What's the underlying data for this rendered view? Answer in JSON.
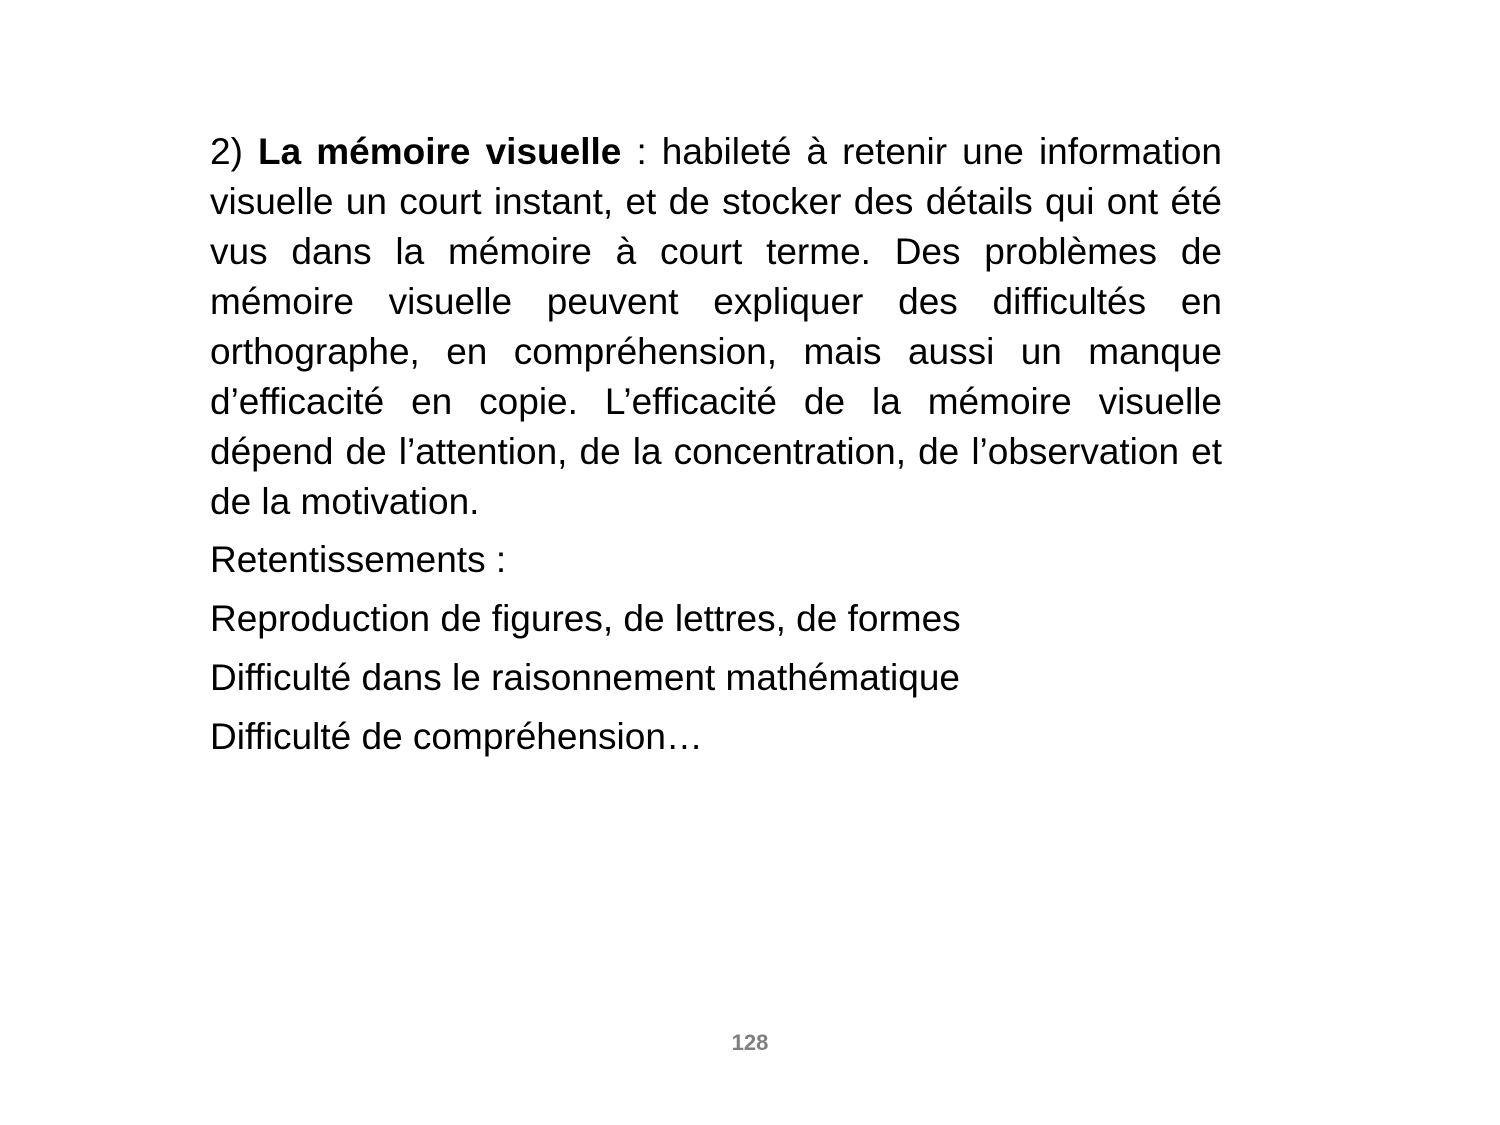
{
  "document": {
    "paragraph": {
      "number": "2)",
      "term": "La mémoire visuelle",
      "definition": ": habileté à retenir une information visuelle un court instant, et de stocker des détails qui ont été vus dans la mémoire à court terme. Des problèmes de mémoire visuelle peuvent expliquer des difficultés en orthographe, en compréhension, mais aussi un manque d’efficacité en copie. L’efficacité de la mémoire visuelle dépend de l’attention, de la concentration, de l’observation et de la motivation."
    },
    "retentissements_heading": "Retentissements :",
    "items": [
      "Reproduction de figures, de lettres, de formes",
      "Difficulté dans le raisonnement mathématique",
      "Difficulté de compréhension…"
    ]
  },
  "footer": {
    "page_number": "128"
  }
}
